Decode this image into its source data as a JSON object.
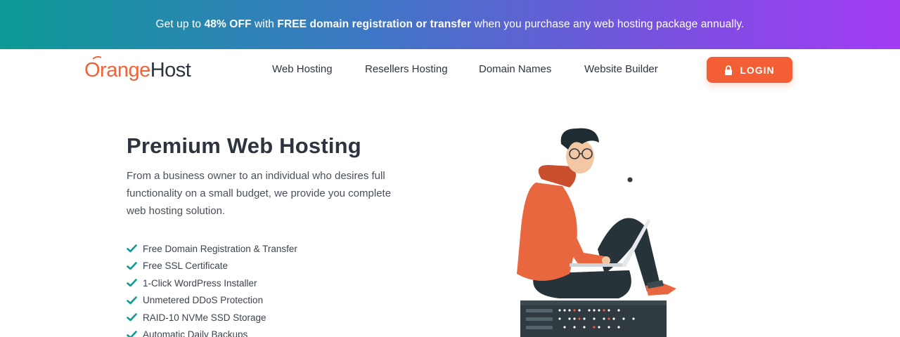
{
  "promo": {
    "prefix": "Get up to ",
    "discount": "48% OFF",
    "mid": " with ",
    "offer": "FREE domain registration or transfer",
    "suffix": " when you purchase any web hosting package annually."
  },
  "brand": {
    "part1": "Orange",
    "part2": "Host",
    "accent_color": "#f06237",
    "dark_color": "#2d3440"
  },
  "nav": {
    "items": [
      {
        "label": "Web Hosting"
      },
      {
        "label": "Resellers Hosting"
      },
      {
        "label": "Domain Names"
      },
      {
        "label": "Website Builder"
      }
    ],
    "login_label": "LOGIN",
    "login_icon": "lock-icon"
  },
  "hero": {
    "title": "Premium Web Hosting",
    "description": "From a business owner to an individual who desires full functionality on a small budget, we provide you complete web hosting solution.",
    "features": [
      "Free Domain Registration & Transfer",
      "Free SSL Certificate",
      "1-Click WordPress Installer",
      "Unmetered DDoS Protection",
      "RAID-10 NVMe SSD Storage",
      "Automatic Daily Backups"
    ],
    "check_icon": "check-icon",
    "check_color": "#0e9a94"
  },
  "colors": {
    "gradient_start": "#0d9a96",
    "gradient_end": "#a23cf5",
    "button": "#f45e35"
  }
}
